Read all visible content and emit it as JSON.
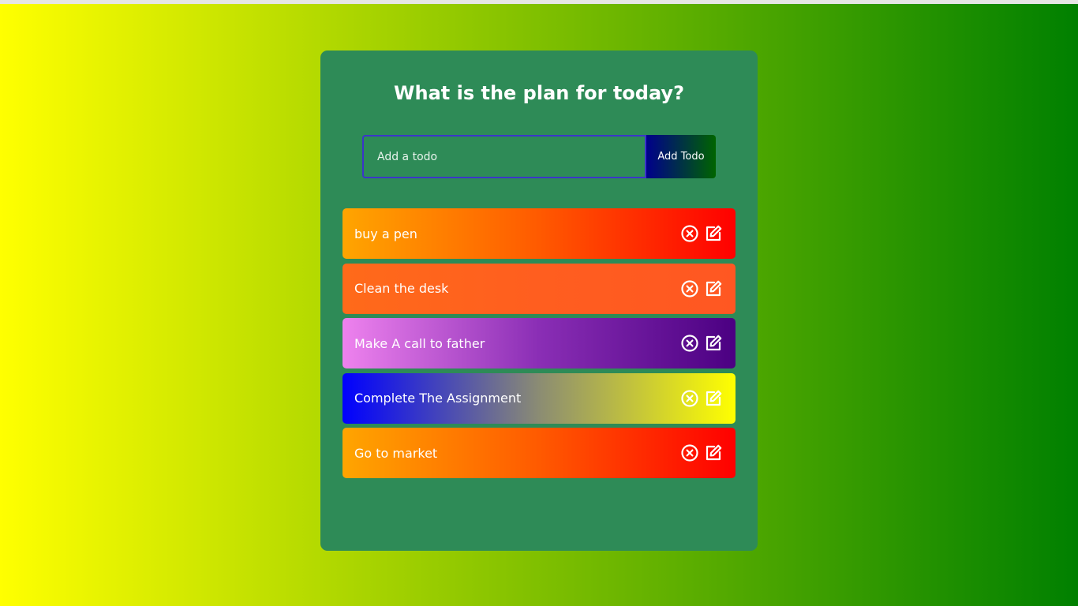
{
  "header": {
    "title": "What is the plan for today?"
  },
  "form": {
    "input_value": "",
    "input_placeholder": "Add a todo",
    "add_button_label": "Add Todo"
  },
  "todos": [
    {
      "text": "buy a pen",
      "gradient": [
        "#ffa500",
        "#ff5a00",
        "#ff0000"
      ]
    },
    {
      "text": "Clean the desk",
      "gradient": [
        "#ff6a1a",
        "#ff5e1f",
        "#ff5722"
      ]
    },
    {
      "text": "Make A call to father",
      "gradient": [
        "#ee82ee",
        "#8a2eb5",
        "#4b0082"
      ]
    },
    {
      "text": "Complete The Assignment",
      "gradient": [
        "#0000ff",
        "#8b8c73",
        "#ffff00"
      ]
    },
    {
      "text": "Go to market",
      "gradient": [
        "#ffa500",
        "#ff5a00",
        "#ff0000"
      ]
    }
  ],
  "icons": {
    "delete": "close-circle-icon",
    "edit": "edit-icon"
  },
  "colors": {
    "page_gradient_start": "#ffff00",
    "page_gradient_end": "#008000",
    "card_background": "#2e8b57",
    "input_border": "#3b35c9",
    "button_gradient_start": "#00008b",
    "button_gradient_end": "#006400"
  }
}
